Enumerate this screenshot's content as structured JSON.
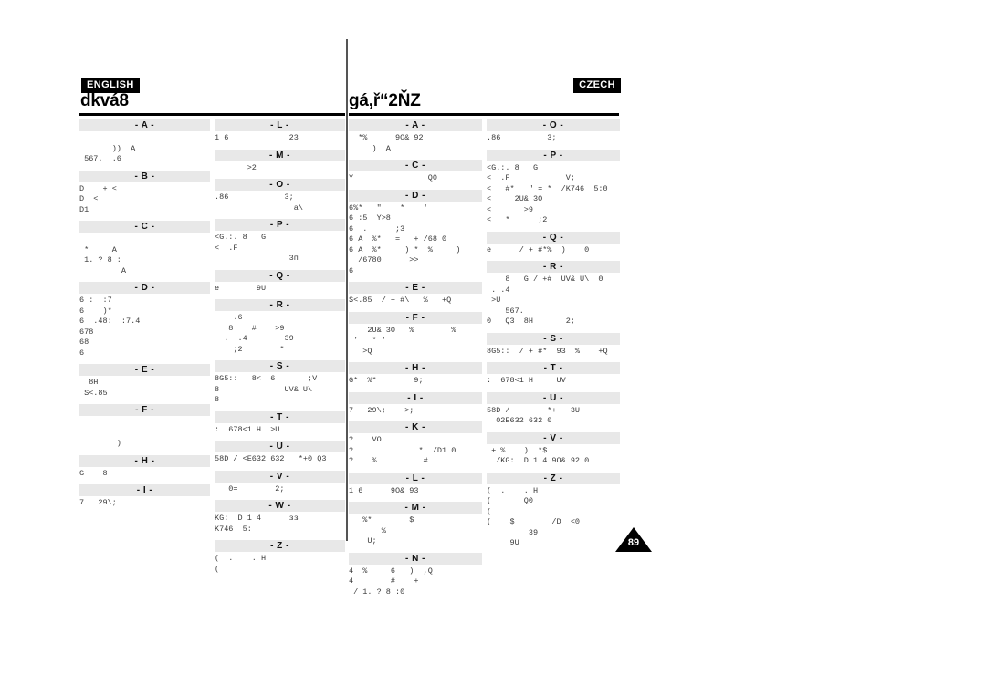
{
  "document": {
    "page_number": "89",
    "page_marker_name": "page-number-triangle"
  },
  "pages": [
    {
      "language_badge": "ENGLISH",
      "title": "dkvá8",
      "columns": [
        {
          "sections": [
            {
              "letter": "- A -",
              "entries": [
                "",
                "       ))  A",
                " 567.  .6"
              ]
            },
            {
              "letter": "- B -",
              "entries": [
                "D    + <",
                "D  <",
                "D1"
              ]
            },
            {
              "letter": "- C -",
              "entries": [
                "",
                " *     A",
                " 1. ? 8 :",
                "         A"
              ]
            },
            {
              "letter": "- D -",
              "entries": [
                "6 :  :7",
                "6    )*",
                "6  .48:  :7.4",
                "678",
                "68",
                "6"
              ]
            },
            {
              "letter": "- E -",
              "entries": [
                "  8H",
                " S<.85"
              ]
            },
            {
              "letter": "- F -",
              "entries": [
                "",
                "",
                "        )"
              ]
            },
            {
              "letter": "- H -",
              "entries": [
                "G    8"
              ]
            },
            {
              "letter": "- I -",
              "entries": [
                "7   29\\;"
              ]
            }
          ]
        },
        {
          "sections": [
            {
              "letter": "- L -",
              "entries": [
                "1 6             23"
              ]
            },
            {
              "letter": "- M -",
              "entries": [
                "       >2"
              ]
            },
            {
              "letter": "- O -",
              "entries": [
                ".86            3;",
                "                 a\\"
              ]
            },
            {
              "letter": "- P -",
              "entries": [
                "<G.:. 8   G",
                "<  .F",
                "                3п"
              ]
            },
            {
              "letter": "- Q -",
              "entries": [
                "e        9U"
              ]
            },
            {
              "letter": "- R -",
              "entries": [
                "    .6",
                "   8    #    >9",
                "  .  .4        39",
                "    ;2        *"
              ]
            },
            {
              "letter": "- S -",
              "entries": [
                "8G5::   8<  6       ;V",
                "8              UV& U\\",
                "8"
              ]
            },
            {
              "letter": "- T -",
              "entries": [
                ":  678<1 H  >U"
              ]
            },
            {
              "letter": "- U -",
              "entries": [
                "58D / <E632 632   *+0 Q3"
              ]
            },
            {
              "letter": "- V -",
              "entries": [
                "   0=        2;"
              ]
            },
            {
              "letter": "- W -",
              "entries": [
                "KG:  D 1 4      зз",
                "K746  5:"
              ]
            },
            {
              "letter": "- Z -",
              "entries": [
                "(  .    . H",
                "("
              ]
            }
          ]
        }
      ]
    },
    {
      "language_badge": "CZECH",
      "title": "gá,ř“2ŇZ",
      "columns": [
        {
          "sections": [
            {
              "letter": "- A -",
              "entries": [
                "  *%      9O& 92",
                "     )  A"
              ]
            },
            {
              "letter": "- C -",
              "entries": [
                "Y                Q0"
              ]
            },
            {
              "letter": "- D -",
              "entries": [
                "6%*   \"    *    '",
                "6 :5  Y>8",
                "6  .      ;3",
                "6 A  %*   =   + /68 0",
                "6 A  %*     ) *  %     )",
                "  /6780      >>",
                "6"
              ]
            },
            {
              "letter": "- E -",
              "entries": [
                "S<.85  / + #\\   %   +Q"
              ]
            },
            {
              "letter": "- F -",
              "entries": [
                "    2U& 3O   %        %",
                " '   * '",
                "   >Q"
              ]
            },
            {
              "letter": "- H -",
              "entries": [
                "G*  %*        9;"
              ]
            },
            {
              "letter": "- I -",
              "entries": [
                "7   29\\;    >;"
              ]
            },
            {
              "letter": "- K -",
              "entries": [
                "?    VO",
                "?              *  /D1 0",
                "?    %          #"
              ]
            },
            {
              "letter": "- L -",
              "entries": [
                "1 6      9O& 93"
              ]
            },
            {
              "letter": "- M -",
              "entries": [
                "   %*        $",
                "       %",
                "    U;"
              ]
            },
            {
              "letter": "- N -",
              "entries": [
                "4  %     6   )  ,Q",
                "4        #    +",
                " / 1. ? 8 :0"
              ]
            }
          ]
        },
        {
          "sections": [
            {
              "letter": "- O -",
              "entries": [
                ".86          3;"
              ]
            },
            {
              "letter": "- P -",
              "entries": [
                "<G.:. 8   G",
                "<  .F            V;",
                "<   #*   \" = *  /K746  5:0",
                "<     2U& 3O",
                "<       >9",
                "<   *      ;2"
              ]
            },
            {
              "letter": "- Q -",
              "entries": [
                "e      / + #*%  )    0"
              ]
            },
            {
              "letter": "- R -",
              "entries": [
                "    8   G / +#  UV& U\\  0",
                " . .4",
                " >U",
                "    567.",
                "0   Q3  8H       2;"
              ]
            },
            {
              "letter": "- S -",
              "entries": [
                "8G5::  / + #*  93  %    +Q"
              ]
            },
            {
              "letter": "- T -",
              "entries": [
                ":  678<1 H     UV"
              ]
            },
            {
              "letter": "- U -",
              "entries": [
                "58D /        *+   3U",
                "  02E632 632 0"
              ]
            },
            {
              "letter": "- V -",
              "entries": [
                " + %    )  *$",
                "  /KG:  D 1 4 9O& 92 0"
              ]
            },
            {
              "letter": "- Z -",
              "entries": [
                "(  .    . H",
                "(       Q0",
                "(",
                "(    $        /D  <0",
                "         39",
                "     9U"
              ]
            }
          ]
        }
      ]
    }
  ]
}
